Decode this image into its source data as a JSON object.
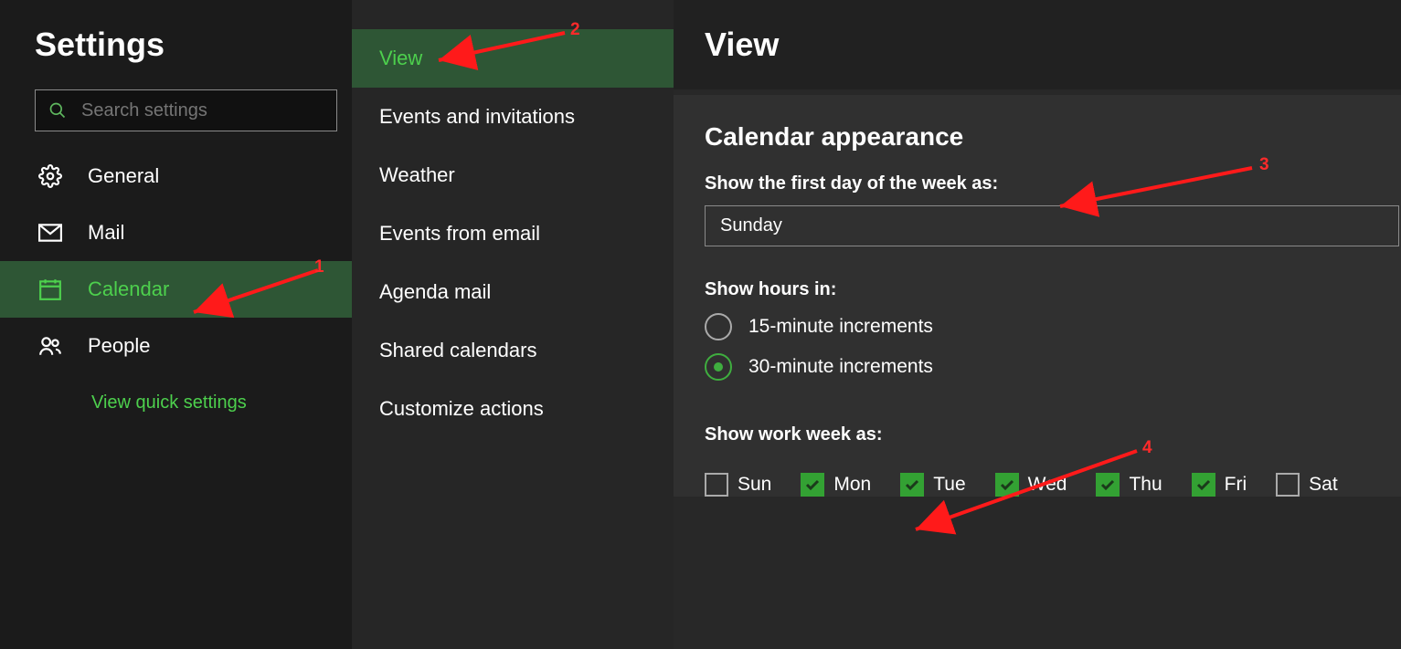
{
  "panel_title": "Settings",
  "search": {
    "placeholder": "Search settings"
  },
  "nav": {
    "items": [
      {
        "label": "General"
      },
      {
        "label": "Mail"
      },
      {
        "label": "Calendar"
      },
      {
        "label": "People"
      }
    ],
    "quick_link": "View quick settings"
  },
  "sub_panel": {
    "items": [
      {
        "label": "View"
      },
      {
        "label": "Events and invitations"
      },
      {
        "label": "Weather"
      },
      {
        "label": "Events from email"
      },
      {
        "label": "Agenda mail"
      },
      {
        "label": "Shared calendars"
      },
      {
        "label": "Customize actions"
      }
    ]
  },
  "content": {
    "header": "View",
    "section_title": "Calendar appearance",
    "first_day_label": "Show the first day of the week as:",
    "first_day_value": "Sunday",
    "hours_label": "Show hours in:",
    "hours_options": [
      {
        "label": "15-minute increments",
        "selected": false
      },
      {
        "label": "30-minute increments",
        "selected": true
      }
    ],
    "work_week_label": "Show work week as:",
    "days": [
      {
        "label": "Sun",
        "checked": false
      },
      {
        "label": "Mon",
        "checked": true
      },
      {
        "label": "Tue",
        "checked": true
      },
      {
        "label": "Wed",
        "checked": true
      },
      {
        "label": "Thu",
        "checked": true
      },
      {
        "label": "Fri",
        "checked": true
      },
      {
        "label": "Sat",
        "checked": false
      }
    ]
  },
  "annotations": [
    "1",
    "2",
    "3",
    "4"
  ]
}
